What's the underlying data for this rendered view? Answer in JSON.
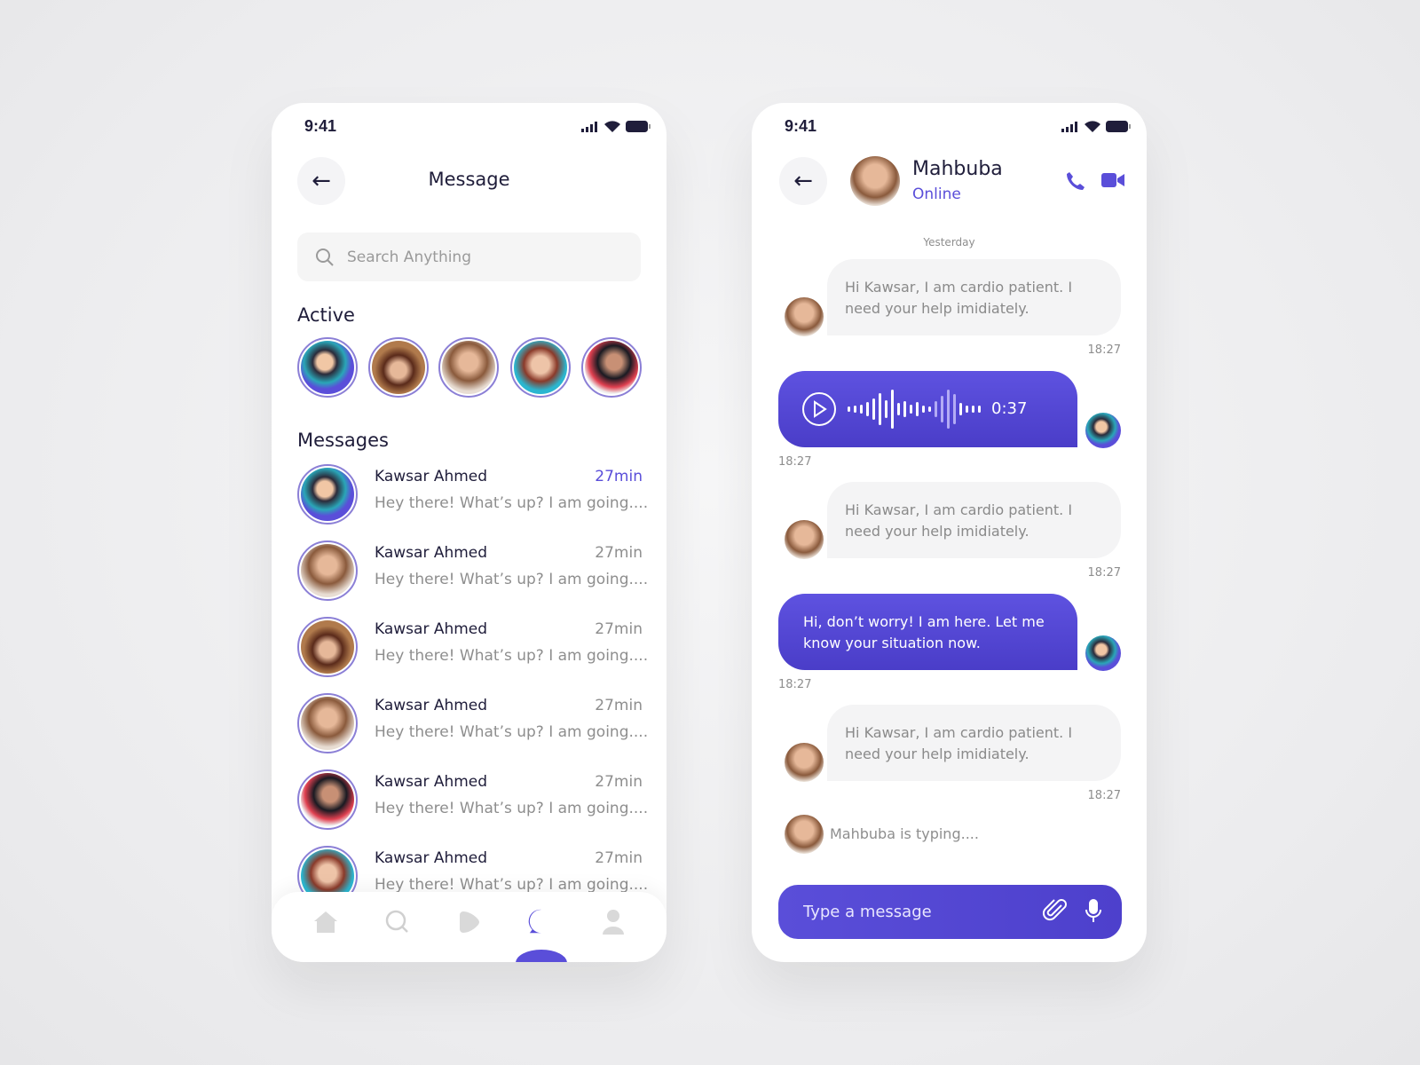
{
  "colors": {
    "accent": "#5a4ed9",
    "text": "#1f1d3a",
    "muted": "#8e8e8e"
  },
  "list_screen": {
    "status_time": "9:41",
    "title": "Message",
    "search_placeholder": "Search Anything",
    "active_heading": "Active",
    "active_users": [
      {
        "avatar": "cartoon-man"
      },
      {
        "avatar": "woman-hat"
      },
      {
        "avatar": "woman-brown-hair"
      },
      {
        "avatar": "woman-red-hair"
      },
      {
        "avatar": "woman-glasses"
      }
    ],
    "messages_heading": "Messages",
    "messages": [
      {
        "name": "Kawsar Ahmed",
        "preview": "Hey there! What’s up? I am going....",
        "time": "27min",
        "unread": true
      },
      {
        "name": "Kawsar Ahmed",
        "preview": "Hey there! What’s up? I am going....",
        "time": "27min"
      },
      {
        "name": "Kawsar Ahmed",
        "preview": "Hey there! What’s up? I am going....",
        "time": "27min"
      },
      {
        "name": "Kawsar Ahmed",
        "preview": "Hey there! What’s up? I am going....",
        "time": "27min"
      },
      {
        "name": "Kawsar Ahmed",
        "preview": "Hey there! What’s up? I am going....",
        "time": "27min"
      },
      {
        "name": "Kawsar Ahmed",
        "preview": "Hey there! What’s up? I am going....",
        "time": "27min"
      }
    ],
    "nav": [
      {
        "icon": "home-icon"
      },
      {
        "icon": "search-icon"
      },
      {
        "icon": "play-icon"
      },
      {
        "icon": "chat-icon",
        "active": true
      },
      {
        "icon": "profile-icon"
      }
    ]
  },
  "chat_screen": {
    "status_time": "9:41",
    "contact_name": "Mahbuba",
    "contact_status": "Online",
    "date_label": "Yesterday",
    "messages": [
      {
        "type": "in",
        "text": "Hi Kawsar, I am cardio patient. I need your help imidiately.",
        "time": "18:27"
      },
      {
        "type": "voice",
        "duration": "0:37",
        "time": "18:27"
      },
      {
        "type": "in",
        "text": "Hi Kawsar, I am cardio patient. I need your help imidiately.",
        "time": "18:27"
      },
      {
        "type": "out",
        "text": "Hi, don’t worry! I am here. Let me know your situation now.",
        "time": "18:27"
      },
      {
        "type": "in",
        "text": "Hi Kawsar, I am cardio patient. I need your help imidiately.",
        "time": "18:27"
      }
    ],
    "typing": "Mahbuba is typing....",
    "input_placeholder": "Type a message"
  }
}
